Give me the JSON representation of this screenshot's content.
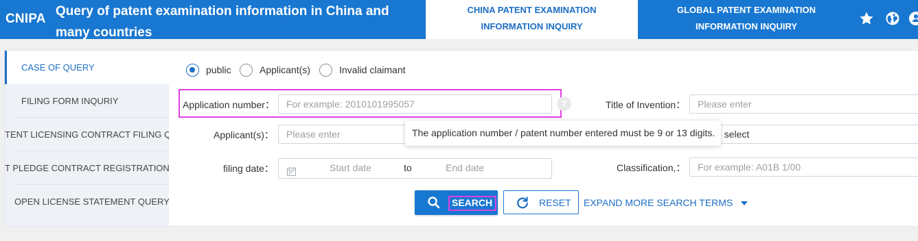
{
  "header": {
    "logo": "CNIPA",
    "title": "Query of patent examination information in China and many countries",
    "tabs": [
      {
        "label_line1": "CHINA PATENT EXAMINATION",
        "label_line2": "INFORMATION INQUIRY",
        "active": true
      },
      {
        "label_line1": "GLOBAL PATENT EXAMINATION",
        "label_line2": "INFORMATION INQUIRY",
        "active": false
      }
    ],
    "icons": [
      "star-icon",
      "globe-icon",
      "user-icon"
    ]
  },
  "sidebar": {
    "items": [
      {
        "label": "CASE OF QUERY",
        "active": true
      },
      {
        "label": "FILING FORM INQURIY"
      },
      {
        "label": "TENT LICENSING CONTRACT FILING Q"
      },
      {
        "label": "T PLEDGE CONTRACT REGISTRATION"
      },
      {
        "label": "OPEN LICENSE STATEMENT QUERY"
      }
    ]
  },
  "query_type": {
    "options": [
      "public",
      "Applicant(s)",
      "Invalid claimant"
    ],
    "selected": "public"
  },
  "form": {
    "application_number": {
      "label": "Application number：",
      "placeholder": "For example: 2010101995057"
    },
    "help": "?",
    "title_of_invention": {
      "label": "Title of Invention：",
      "placeholder": "Please enter"
    },
    "applicant": {
      "label": "Applicant(s)：",
      "placeholder": "Please enter"
    },
    "select_partial": {
      "placeholder": "e select"
    },
    "filing_date": {
      "label": "filing date：",
      "start_placeholder": "Start date",
      "separator": "to",
      "end_placeholder": "End date"
    },
    "classification": {
      "label": "Classification,：",
      "placeholder": "For example: A01B 1/00"
    }
  },
  "tooltip": "The application number / patent number entered must be 9 or 13 digits.",
  "buttons": {
    "search": "SEARCH",
    "reset": "RESET",
    "expand": "EXPAND MORE SEARCH TERMS"
  },
  "colors": {
    "brand_blue": "#1877d1",
    "highlight_magenta": "#e040e0",
    "page_background": "#f0f0f0"
  }
}
